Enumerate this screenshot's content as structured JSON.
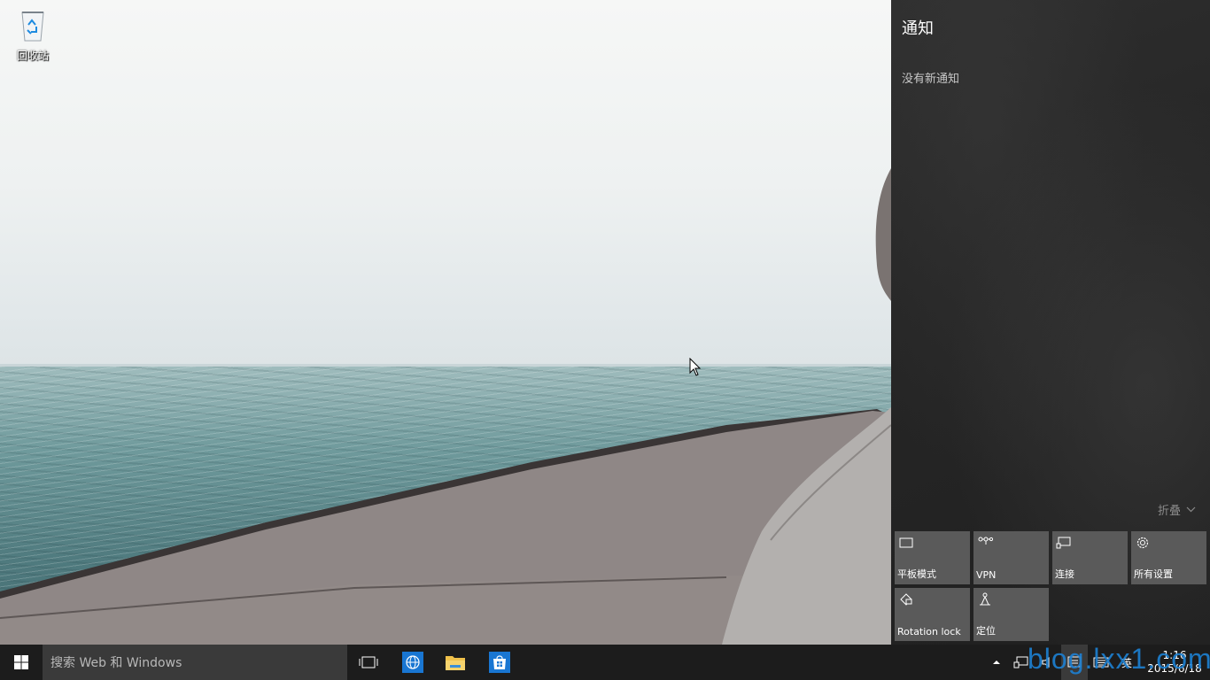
{
  "desktop": {
    "icons": [
      {
        "label": "回收站",
        "icon": "recycle-bin-icon"
      }
    ]
  },
  "action_center": {
    "title": "通知",
    "empty_text": "没有新通知",
    "collapse_label": "折叠",
    "quick_actions": [
      {
        "label": "平板模式",
        "icon": "tablet-mode-icon"
      },
      {
        "label": "VPN",
        "icon": "vpn-icon"
      },
      {
        "label": "连接",
        "icon": "connect-icon"
      },
      {
        "label": "所有设置",
        "icon": "gear-icon"
      },
      {
        "label": "Rotation lock",
        "icon": "rotation-lock-icon"
      },
      {
        "label": "定位",
        "icon": "location-icon"
      }
    ]
  },
  "taskbar": {
    "search_placeholder": "搜索 Web 和 Windows",
    "pinned": [
      {
        "name": "task-view",
        "icon": "task-view-icon"
      },
      {
        "name": "browser",
        "icon": "globe-icon"
      },
      {
        "name": "file-explorer",
        "icon": "folder-icon"
      },
      {
        "name": "store",
        "icon": "store-icon"
      }
    ],
    "tray": {
      "ime_label": "英",
      "time": "1:16",
      "date": "2015/6/18"
    }
  },
  "watermark": "blog.lxx1.com",
  "colors": {
    "taskbar_bg": "#1c1c1c",
    "action_center_bg": "#262626",
    "tile_bg": "#5a5a5a",
    "accent_blue": "#1d7fd0"
  }
}
